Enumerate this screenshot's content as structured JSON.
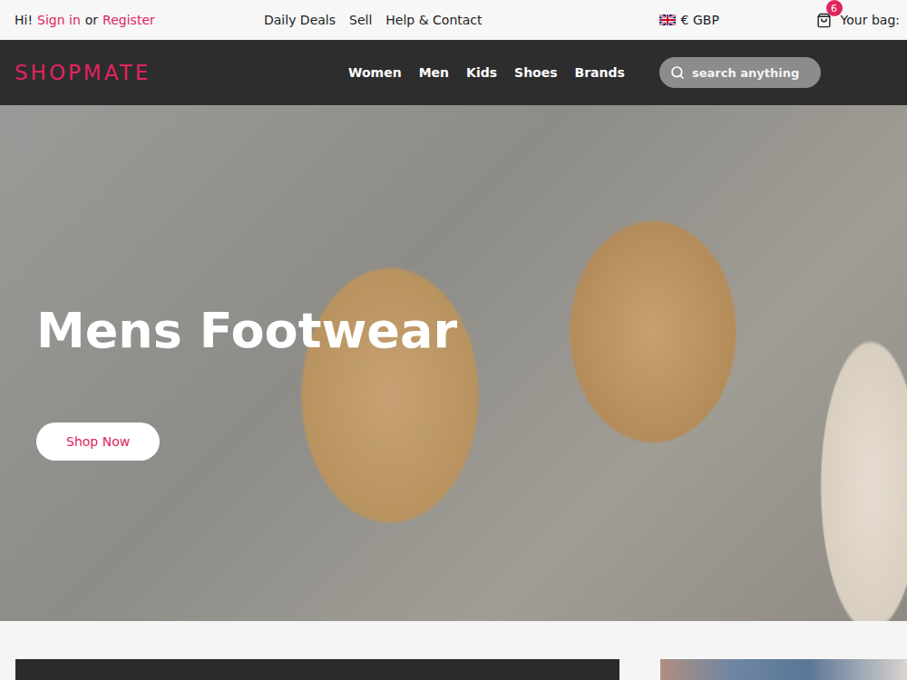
{
  "topbar": {
    "greeting": "Hi!",
    "sign_in": "Sign in",
    "or": "or",
    "register": "Register",
    "links": [
      "Daily Deals",
      "Sell",
      "Help & Contact"
    ],
    "currency": "€ GBP",
    "bag": {
      "count": "6",
      "label": "Your bag:"
    }
  },
  "nav": {
    "logo": "SHOPMATE",
    "links": [
      "Women",
      "Men",
      "Kids",
      "Shoes",
      "Brands"
    ],
    "search": {
      "placeholder": "search anything"
    }
  },
  "hero": {
    "title": "Mens Footwear",
    "button": "Shop Now"
  }
}
